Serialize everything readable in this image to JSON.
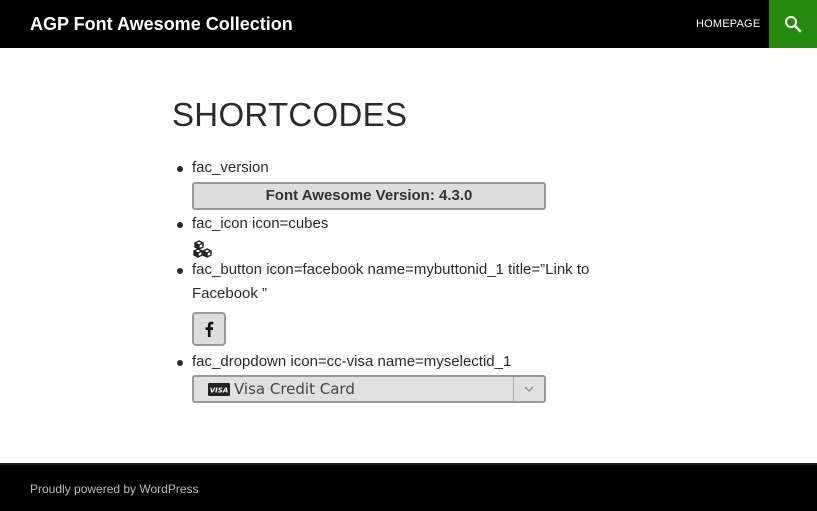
{
  "header": {
    "site_title": "AGP Font Awesome Collection",
    "nav": [
      "HOMEPAGE"
    ],
    "search_icon": "search-icon",
    "accent_color": "#24890d"
  },
  "main": {
    "title": "SHORTCODES",
    "items": [
      {
        "text": "fac_version",
        "output": "Font Awesome Version: 4.3.0"
      },
      {
        "text": "fac_icon icon=cubes",
        "icon": "cubes-icon"
      },
      {
        "text": "fac_button icon=facebook name=mybuttonid_1 title=”Link to Facebook ”",
        "icon": "facebook-icon"
      },
      {
        "text": "fac_dropdown icon=cc-visa name=myselectid_1",
        "select_value": "Visa Credit Card",
        "icon": "cc-visa-icon"
      }
    ]
  },
  "footer": {
    "credit": "Proudly powered by WordPress"
  }
}
